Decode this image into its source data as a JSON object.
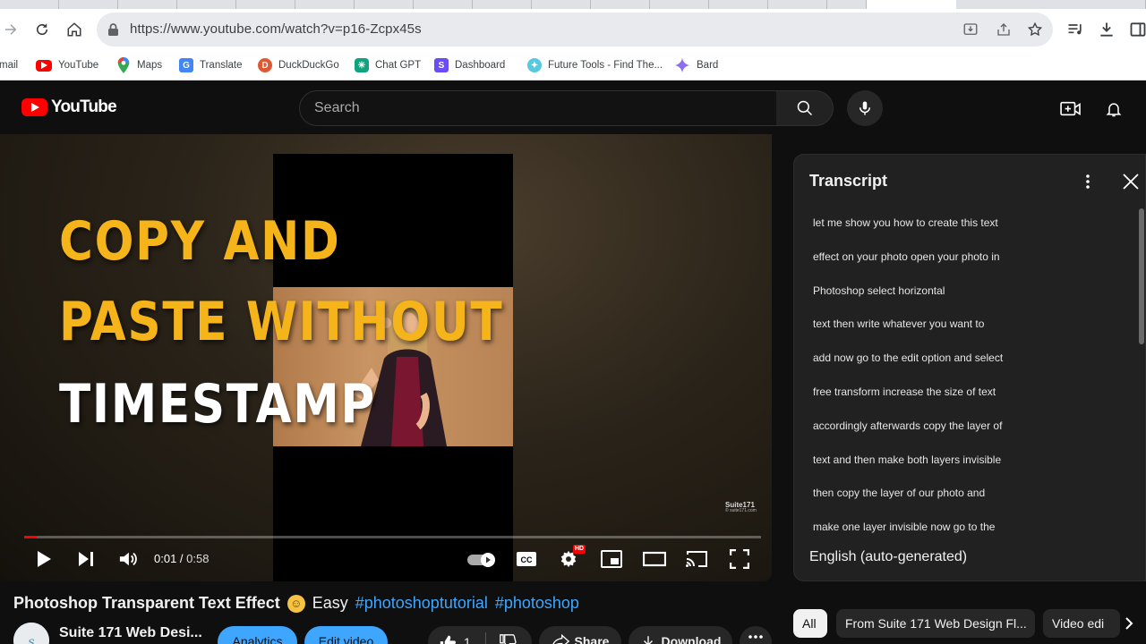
{
  "browser": {
    "url": "https://www.youtube.com/watch?v=p16-Zcpx45s",
    "bookmarks": [
      {
        "label": "mail",
        "icon": "gmail-icon",
        "color": "#ea4335"
      },
      {
        "label": "YouTube",
        "icon": "youtube-icon",
        "color": "#ff0000"
      },
      {
        "label": "Maps",
        "icon": "maps-icon",
        "color": "#34a853"
      },
      {
        "label": "Translate",
        "icon": "translate-icon",
        "color": "#4285f4"
      },
      {
        "label": "DuckDuckGo",
        "icon": "duckduckgo-icon",
        "color": "#de5833"
      },
      {
        "label": "Chat GPT",
        "icon": "chatgpt-icon",
        "color": "#10a37f"
      },
      {
        "label": "Dashboard",
        "icon": "dashboard-icon",
        "color": "#6c4cf5"
      },
      {
        "label": "Future Tools - Find The...",
        "icon": "future-tools-icon",
        "color": "#56c8e0"
      },
      {
        "label": "Bard",
        "icon": "bard-icon",
        "color": "#8e6cf0"
      }
    ]
  },
  "youtube": {
    "logo_text": "YouTube",
    "search_placeholder": "Search"
  },
  "player": {
    "overlay_lines": [
      "COPY AND",
      "PASTE WITHOUT",
      "TIMESTAMP"
    ],
    "watermark": "Suite171",
    "watermark_sub": "© suite171.com",
    "current_time": "0:01",
    "duration": "0:58",
    "progress_fraction": 0.017,
    "hd_badge": "HD",
    "accent_color": "#ff0000"
  },
  "transcript": {
    "title": "Transcript",
    "lines": [
      "let me show you how to create this text",
      "effect on your photo open your photo in",
      "Photoshop select horizontal",
      "text then write whatever you want to",
      "add now go to the edit option and select",
      "free transform increase the size of text",
      "accordingly afterwards copy the layer of",
      "text and then make both layers invisible",
      "then copy the layer of our photo and",
      "make one layer invisible now go to the"
    ],
    "language": "English (auto-generated)"
  },
  "video": {
    "title": "Photoshop Transparent Text Effect",
    "title_suffix": "Easy",
    "hashtags": [
      "#photoshoptutorial",
      "#photoshop"
    ],
    "channel": "Suite 171 Web Desi...",
    "analytics_label": "Analytics",
    "edit_label": "Edit video",
    "like_count": "1",
    "share_label": "Share",
    "download_label": "Download"
  },
  "chips": [
    "All",
    "From Suite 171 Web Design Fl...",
    "Video edi"
  ]
}
